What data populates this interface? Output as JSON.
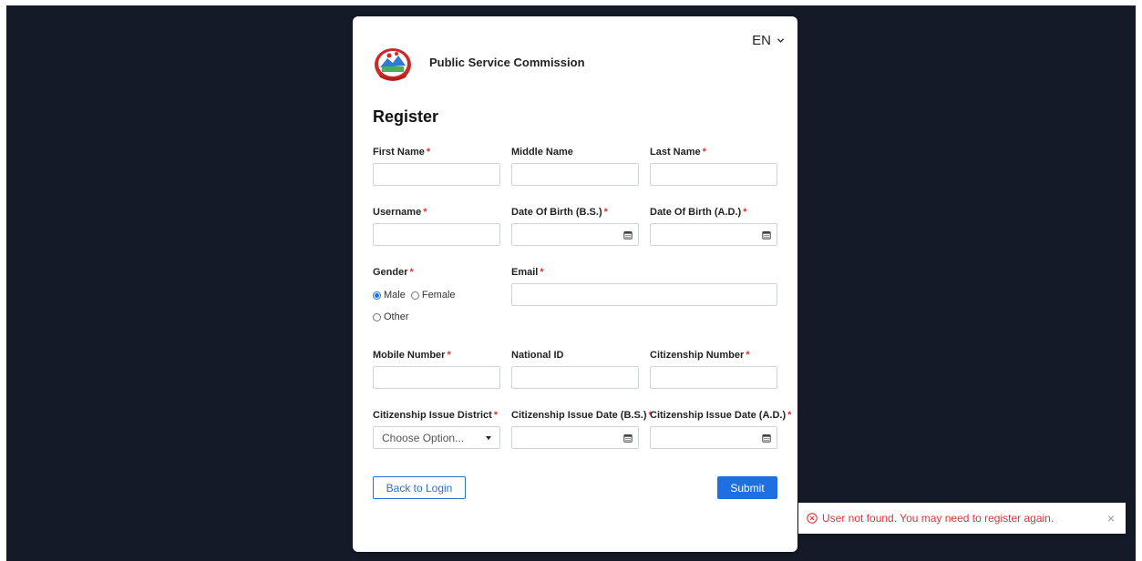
{
  "header": {
    "language": "EN",
    "organization": "Public Service Commission"
  },
  "form": {
    "title": "Register",
    "required_marker": "*",
    "fields": {
      "first_name": {
        "label": "First Name"
      },
      "middle_name": {
        "label": "Middle Name"
      },
      "last_name": {
        "label": "Last Name"
      },
      "username": {
        "label": "Username"
      },
      "dob_bs": {
        "label": "Date Of Birth (B.S.)"
      },
      "dob_ad": {
        "label": "Date Of Birth (A.D.)"
      },
      "gender": {
        "label": "Gender",
        "options": [
          "Male",
          "Female",
          "Other"
        ],
        "selected": "Male"
      },
      "email": {
        "label": "Email"
      },
      "mobile": {
        "label": "Mobile Number"
      },
      "national_id": {
        "label": "National ID"
      },
      "citizenship_number": {
        "label": "Citizenship Number"
      },
      "issue_district": {
        "label": "Citizenship Issue District",
        "selected_text": "Choose Option..."
      },
      "issue_date_bs": {
        "label": "Citizenship Issue Date (B.S.)"
      },
      "issue_date_ad": {
        "label": "Citizenship Issue Date (A.D.)"
      }
    },
    "buttons": {
      "back": "Back to Login",
      "submit": "Submit"
    }
  },
  "toast": {
    "message": "User not found. You may need to register again.",
    "close": "×"
  },
  "colors": {
    "backdrop": "#151a28",
    "primary": "#1f6fe0",
    "required": "#e03131",
    "error": "#e0323c"
  }
}
